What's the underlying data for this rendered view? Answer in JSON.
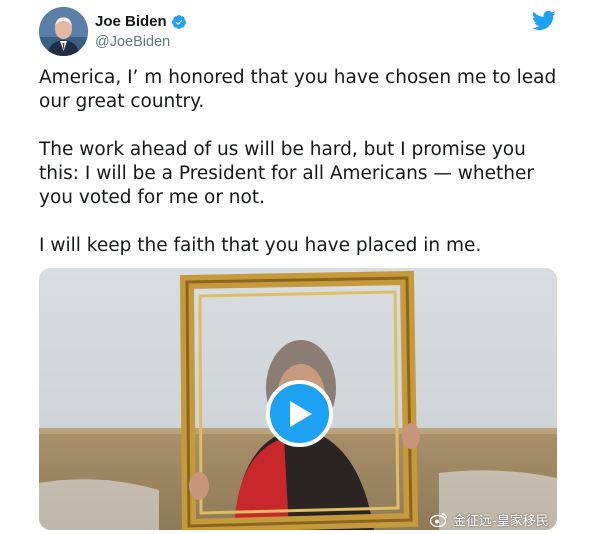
{
  "author": {
    "name": "Joe Biden",
    "handle": "@JoeBiden",
    "verified_icon": "verified-badge-icon",
    "brand_color": "#1da1f2"
  },
  "tweet": {
    "paragraphs": [
      "America, I’ m honored that you have chosen me to lead\nour great country.",
      "The work ahead of us will be hard, but I promise you\nthis: I will be a President for all Americans — whether\nyou voted for me or not.",
      "I will keep the faith that you have placed in me."
    ]
  },
  "media": {
    "type": "video",
    "play_icon": "play-icon"
  },
  "watermark": {
    "text": "金征远-皇家移民"
  }
}
